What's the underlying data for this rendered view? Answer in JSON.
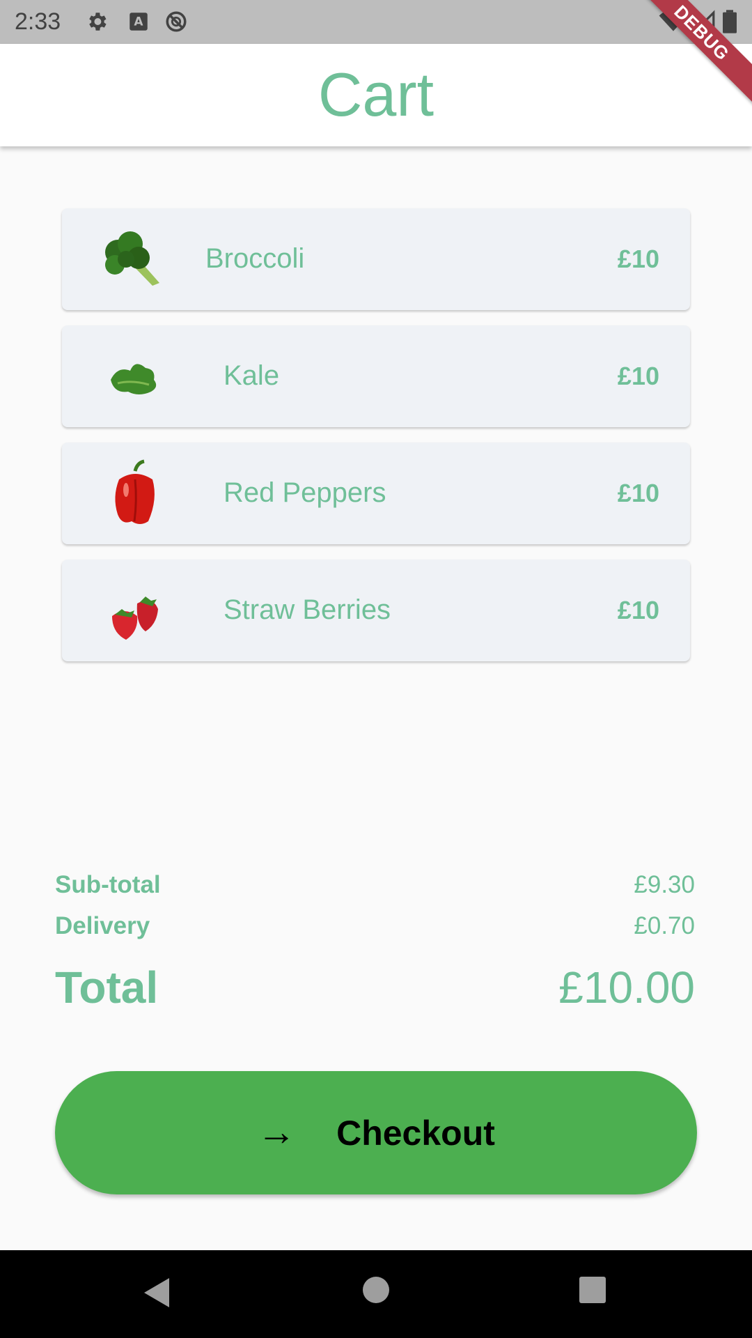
{
  "status_bar": {
    "time": "2:33",
    "icons": [
      "settings-icon",
      "keyboard-a-icon",
      "sync-disabled-icon",
      "wifi-icon",
      "signal-icon",
      "battery-icon"
    ]
  },
  "debug_banner": "DEBUG",
  "app_bar": {
    "title": "Cart"
  },
  "cart": {
    "items": [
      {
        "name": "Broccoli",
        "price": "£10",
        "image": "broccoli-image"
      },
      {
        "name": "Kale",
        "price": "£10",
        "image": "kale-image"
      },
      {
        "name": "Red Peppers",
        "price": "£10",
        "image": "red-pepper-image"
      },
      {
        "name": "Straw Berries",
        "price": "£10",
        "image": "strawberries-image"
      }
    ]
  },
  "summary": {
    "subtotal_label": "Sub-total",
    "subtotal_value": "£9.30",
    "delivery_label": "Delivery",
    "delivery_value": "£0.70",
    "total_label": "Total",
    "total_value": "£10.00"
  },
  "checkout": {
    "arrow": "→",
    "label": "Checkout"
  },
  "colors": {
    "accent": "#6fbf98",
    "button": "#4caf50",
    "card": "#eff2f6",
    "background": "#fafafa"
  }
}
